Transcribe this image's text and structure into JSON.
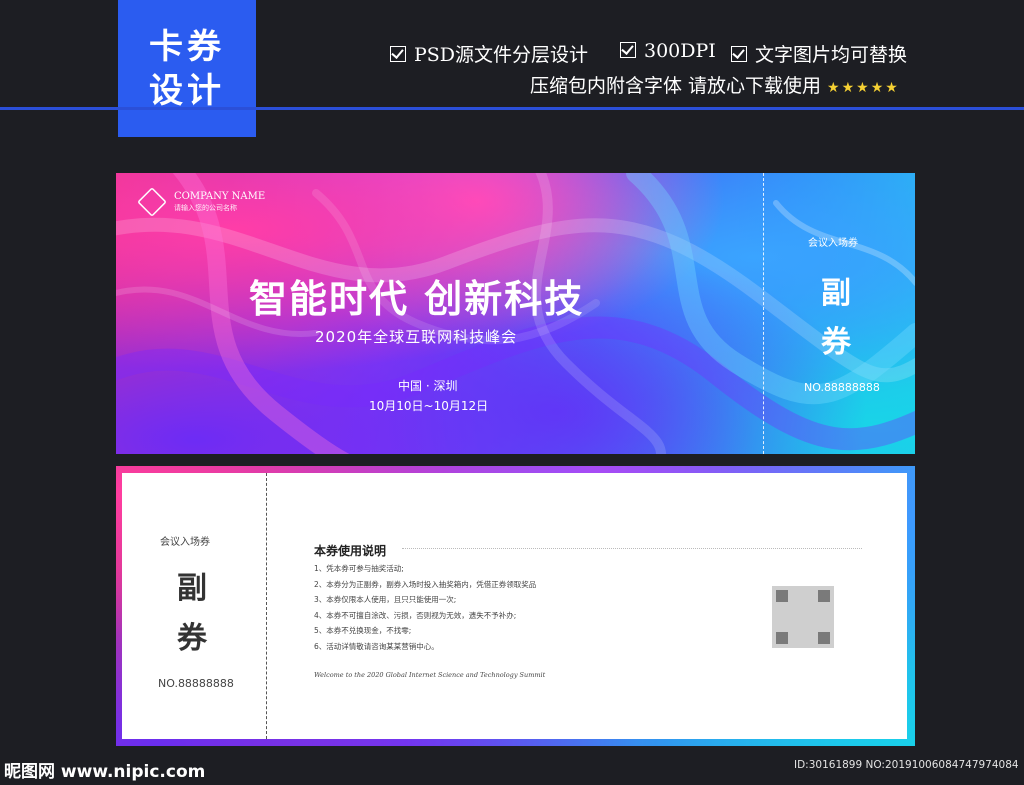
{
  "badge": {
    "line1": "卡券",
    "line2": "设计"
  },
  "features": {
    "f1": "PSD源文件分层设计",
    "f2": "300DPI",
    "f3": "文字图片均可替换",
    "f4": "压缩包内附含字体 请放心下载使用",
    "stars": "★★★★★"
  },
  "ticket_front": {
    "company_name": "COMPANY NAME",
    "company_sub": "请输入您的公司名称",
    "title": "智能时代 创新科技",
    "subtitle": "2020年全球互联网科技峰会",
    "location": "中国 · 深圳",
    "dates": "10月10日~10月12日",
    "stub_label": "会议入场券",
    "stub_big1": "副",
    "stub_big2": "券",
    "stub_no": "NO.88888888"
  },
  "ticket_back": {
    "stub_label": "会议入场券",
    "stub_big1": "副",
    "stub_big2": "券",
    "stub_no": "NO.88888888",
    "rules_title": "本券使用说明",
    "rules": [
      "1、凭本券可参与抽奖活动;",
      "2、本券分为正副券，副券入场时投入抽奖箱内，凭借正券领取奖品",
      "3、本券仅限本人使用，且只只能使用一次;",
      "4、本券不可擅自涂改、污损，否则视为无效，遗失不予补办;",
      "5、本券不兑换现金，不找零;",
      "6、活动详情敬请咨询某某营销中心。"
    ],
    "welcome": "Welcome to the 2020 Global Internet Science and Technology Summit"
  },
  "footer": {
    "site": "昵图网 www.nipic.com",
    "id": "ID:30161899 NO:20191006084747974084"
  }
}
